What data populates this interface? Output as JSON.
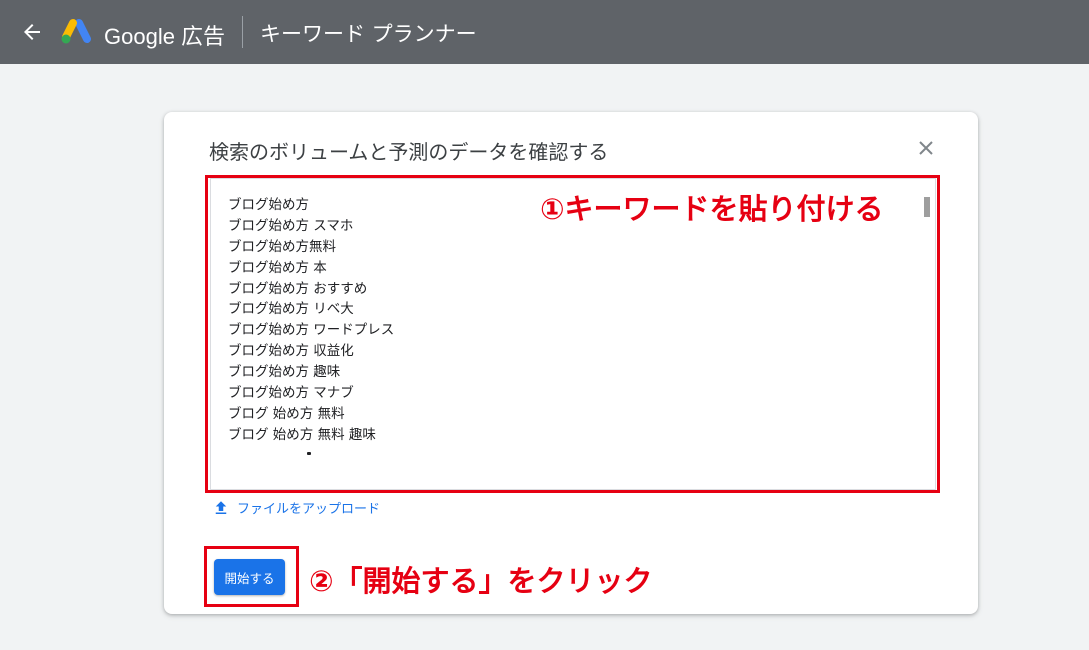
{
  "header": {
    "back_icon": "arrow-left-icon",
    "logo_icon": "google-ads-logo-icon",
    "brand": "Google 広告",
    "tool_title": "キーワード プランナー"
  },
  "dialog": {
    "title": "検索のボリュームと予測のデータを確認する",
    "close_icon": "close-icon",
    "keywords": [
      "ブログ始め方",
      "ブログ始め方 スマホ",
      "ブログ始め方無料",
      "ブログ始め方 本",
      "ブログ始め方 おすすめ",
      "ブログ始め方 リベ大",
      "ブログ始め方 ワードプレス",
      "ブログ始め方 収益化",
      "ブログ始め方 趣味",
      "ブログ始め方 マナブ",
      "ブログ 始め方 無料",
      "ブログ 始め方 無料 趣味"
    ],
    "upload_icon": "upload-icon",
    "upload_label": "ファイルをアップロード",
    "start_button": "開始する"
  },
  "annotations": {
    "step1": "①キーワードを貼り付ける",
    "step2": "②「開始する」をクリック",
    "highlight_color": "#e60012"
  },
  "colors": {
    "topbar": "#5f6368",
    "primary": "#1a73e8",
    "page_bg": "#f1f3f4"
  }
}
